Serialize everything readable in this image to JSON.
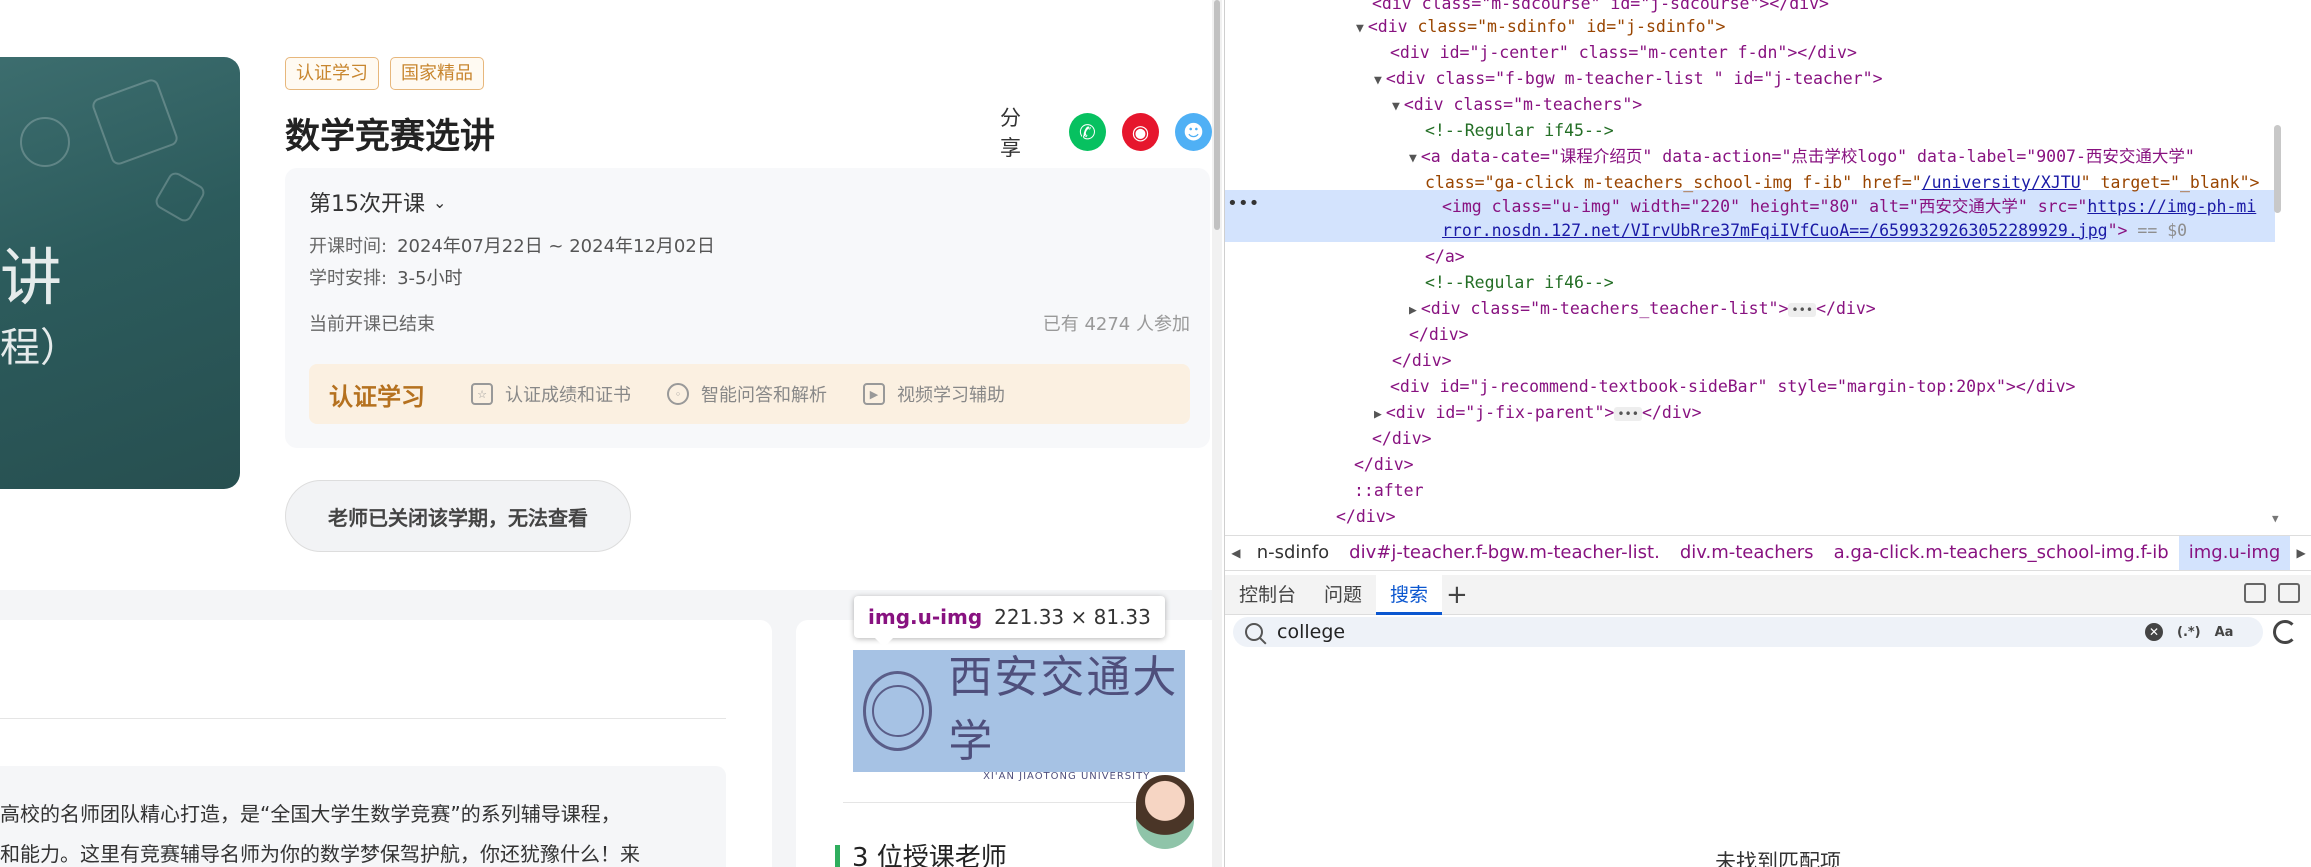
{
  "cover": {
    "text_large": "讲",
    "text_small": "程）"
  },
  "course": {
    "tags": [
      "认证学习",
      "国家精品"
    ],
    "title": "数学竞赛选讲",
    "share_label": "分享",
    "term": "第15次开课",
    "time_label": "开课时间:",
    "time_value": "2024年07月22日 ~ 2024年12月02日",
    "schedule_label": "学时安排:",
    "schedule_value": "3-5小时",
    "status": "当前开课已结束",
    "enrolled": "已有 4274 人参加",
    "cert_title": "认证学习",
    "cert_features": [
      "认证成绩和证书",
      "智能问答和解析",
      "视频学习辅助"
    ],
    "closed_notice": "老师已关闭该学期，无法查看"
  },
  "description": {
    "line1": "高校的名师团队精心打造，是“全国大学生数学竞赛”的系列辅导课程，",
    "line2": "和能力。这里有竞赛辅导名师为你的数学梦保驾护航，你还犹豫什么！来"
  },
  "university": {
    "name_cn": "西安交通大学",
    "name_en": "XI'AN JIAOTONG UNIVERSITY"
  },
  "teachers_heading": "3 位授课老师",
  "tooltip": {
    "tag": "img.u-img",
    "dims": "221.33 × 81.33"
  },
  "devtools": {
    "dom": {
      "l1": "<div class=\"m-sdcourse\" id=\"j-sdcourse\"></div>",
      "l2_tag": "<div ",
      "l2_attrs": "class=\"m-sdinfo\" id=\"j-sdinfo\">",
      "l3": "<div id=\"j-center\" class=\"m-center f-dn\"></div>",
      "l4": "<div class=\"f-bgw m-teacher-list \" id=\"j-teacher\">",
      "l5": "<div class=\"m-teachers\">",
      "l6": "<!--Regular if45-->",
      "l7": "<a data-cate=\"课程介绍页\" data-action=\"点击学校logo\" data-label=\"9007-西安交通大学\"",
      "l8_pre": "class=\"ga-click m-teachers_school-img f-ib\" href=\"",
      "l8_href": "/university/XJTU",
      "l8_post": "\" target=\"_blank\">",
      "l9_pre": "<img class=\"u-img\" width=\"220\" height=\"80\" alt=\"西安交通大学\" src=\"",
      "l9_src1": "https://img-ph-mi",
      "l10_src2": "rror.nosdn.127.net/VIrvUbRre37mFqiIVfCuoA==/6599329263052289929.jpg",
      "l10_post": "\">",
      "l10_eq": "== $0",
      "l11": "</a>",
      "l12": "<!--Regular if46-->",
      "l13": "<div class=\"m-teachers_teacher-list\">",
      "l13_end": "</div>",
      "l14": "</div>",
      "l15": "</div>",
      "l16": "<div id=\"j-recommend-textbook-sideBar\" style=\"margin-top:20px\"></div>",
      "l17": "<div id=\"j-fix-parent\">",
      "l17_end": "</div>",
      "l18": "</div>",
      "l19": "</div>",
      "l20": "::after",
      "l21": "</div>"
    },
    "breadcrumbs": [
      "n-sdinfo",
      "div#j-teacher.f-bgw.m-teacher-list.",
      "div.m-teachers",
      "a.ga-click.m-teachers_school-img.f-ib",
      "img.u-img"
    ],
    "tabs": [
      "控制台",
      "问题",
      "搜索"
    ],
    "search": {
      "value": "college",
      "placeholder": "搜索"
    },
    "search_options": [
      "(.*)",
      "Aa"
    ],
    "no_match": "未找到匹配项"
  },
  "colors": {
    "accent": "#0b57d0",
    "wechat": "#07c160",
    "weibo": "#e6162d",
    "qq": "#4fb0f5",
    "cert": "#b5711f"
  }
}
